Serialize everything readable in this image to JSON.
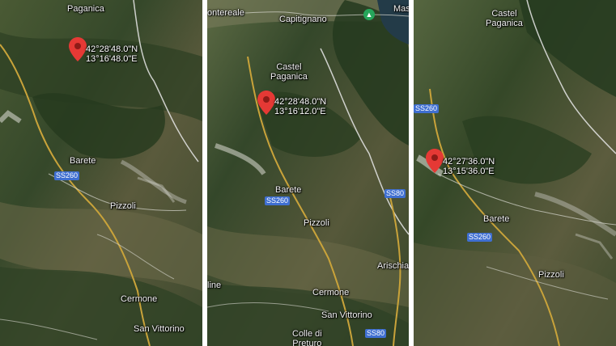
{
  "panels": [
    {
      "places": {
        "paganica": "Paganica",
        "barete": "Barete",
        "pizzoli": "Pizzoli",
        "cermone": "Cermone",
        "san_vittorino": "San Vittorino"
      },
      "roads": {
        "ss260": "SS260"
      },
      "marker": {
        "lat": "42°28'48.0\"N",
        "lon": "13°16'48.0\"E"
      }
    },
    {
      "places": {
        "montereale": "ontereale",
        "capitignano": "Capitignano",
        "mas": "Mas",
        "castel": "Castel",
        "paganica": "Paganica",
        "barete": "Barete",
        "pizzoli": "Pizzoli",
        "arischia": "Arischia",
        "line": "line",
        "cermone": "Cermone",
        "san_vittorino": "San Vittorino",
        "colle": "Colle di",
        "preturo": "Preturo"
      },
      "roads": {
        "ss260": "SS260",
        "ss80_top": "SS80",
        "ss80_bottom": "SS80"
      },
      "marker": {
        "lat": "42°28'48.0\"N",
        "lon": "13°16'12.0\"E"
      }
    },
    {
      "places": {
        "castel": "Castel",
        "paganica": "Paganica",
        "barete": "Barete",
        "pizzoli": "Pizzoli"
      },
      "roads": {
        "ss260_top": "SS260",
        "ss260_bottom": "SS260"
      },
      "marker": {
        "lat": "42°27'36.0\"N",
        "lon": "13°15'36.0\"E"
      }
    }
  ],
  "colors": {
    "marker": "#e53935",
    "road_shield": "#3f6fd1",
    "main_road": "#c9a33a"
  }
}
